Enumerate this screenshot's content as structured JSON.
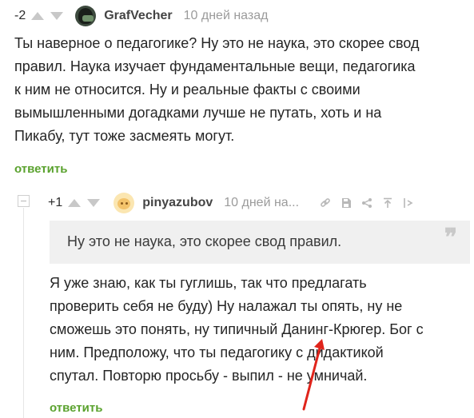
{
  "comment1": {
    "rating": "-2",
    "username": "GrafVecher",
    "time": "10 дней назад",
    "lines": [
      "Ты наверное о педагогике? Ну это не наука, это скорее свод",
      "правил. Наука изучает фундаментальные вещи, педагогика",
      "к ним не относится. Ну и реальные факты с своими",
      "вымышленными догадками лучше не путать, хоть и на",
      "Пикабу, тут тоже засмеять могут."
    ],
    "reply_label": "ответить"
  },
  "comment2": {
    "rating": "+1",
    "username": "pinyazubov",
    "time": "10 дней на...",
    "tools": [
      "link-icon",
      "save-icon",
      "share-icon",
      "scroll-top-icon",
      "more-icon"
    ],
    "quote": "Ну это не наука, это скорее свод правил.",
    "quote_mark": "❞",
    "lines": [
      "Я уже знаю, как ты гуглишь, так что предлагать",
      "проверить себя не буду) Ну налажал ты опять, ну не",
      "сможешь это понять, ну типичный Данинг-Крюгер. Бог с",
      "ним. Предположу, что ты педагогику с дидактикой",
      "спутал. Повторю просьбу - выпил - не умничай."
    ],
    "reply_label": "ответить"
  },
  "colors": {
    "accent_green": "#5aa22e",
    "annotation_red": "#e0241b",
    "muted_text": "#9b9b9b"
  }
}
